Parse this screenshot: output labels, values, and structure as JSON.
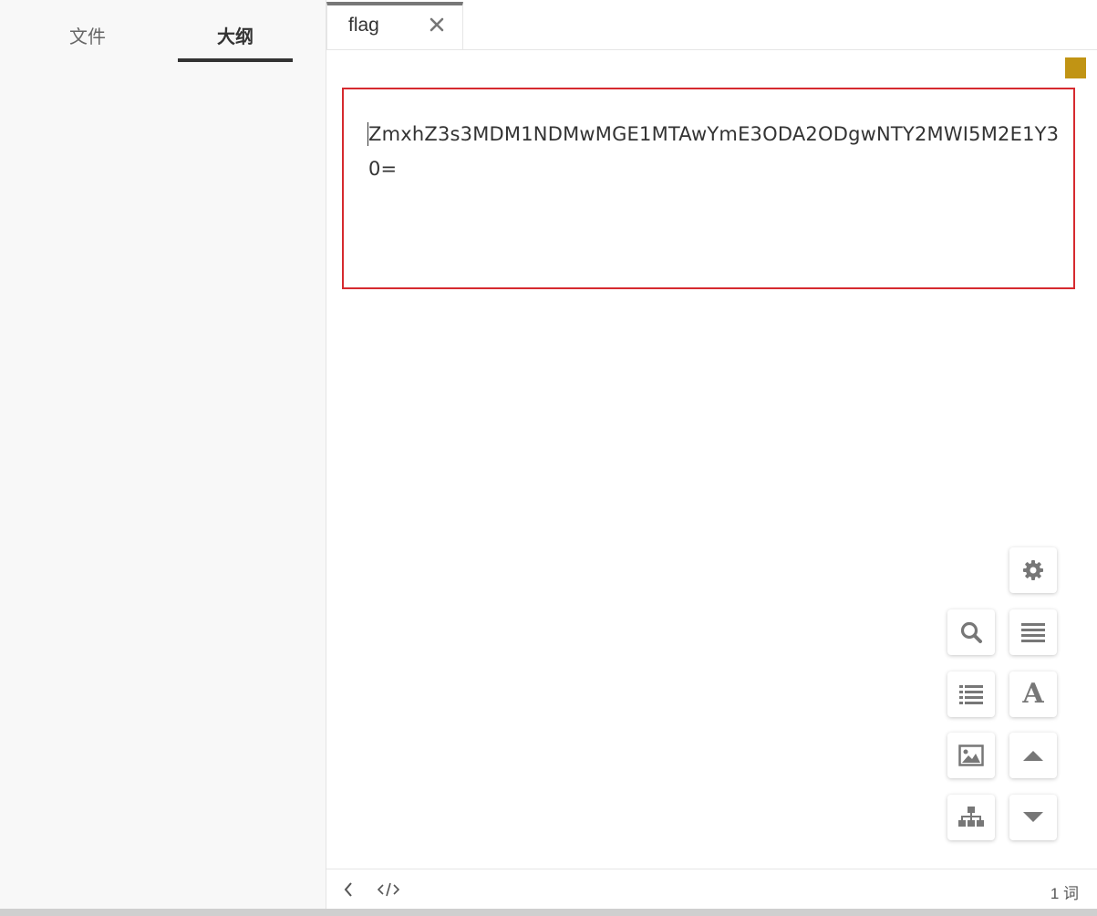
{
  "sidebar": {
    "tabs": [
      {
        "label": "文件",
        "active": false
      },
      {
        "label": "大纲",
        "active": true
      }
    ]
  },
  "tabbar": {
    "tabs": [
      {
        "label": "flag",
        "close_icon": "close-icon"
      }
    ]
  },
  "editor": {
    "content": "ZmxhZ3s3MDM1NDMwMGE1MTAwYmE3ODA2ODgwNTY2MWI5M2E1Y30="
  },
  "colors": {
    "highlight_border": "#d62a2f",
    "status_square": "#c19414",
    "active_tab_border": "#777777"
  },
  "tools": [
    {
      "name": "settings",
      "icon": "gear-icon"
    },
    {
      "name": "search",
      "icon": "search-icon"
    },
    {
      "name": "paragraph",
      "icon": "lines-icon"
    },
    {
      "name": "list",
      "icon": "list-icon"
    },
    {
      "name": "font",
      "icon": "font-icon",
      "label": "A"
    },
    {
      "name": "image",
      "icon": "image-icon"
    },
    {
      "name": "scroll-up",
      "icon": "caret-up-icon"
    },
    {
      "name": "structure",
      "icon": "sitemap-icon"
    },
    {
      "name": "scroll-down",
      "icon": "caret-down-icon"
    }
  ],
  "footer": {
    "word_count": "1 词",
    "icons": [
      "chevron-left-icon",
      "code-icon"
    ]
  }
}
